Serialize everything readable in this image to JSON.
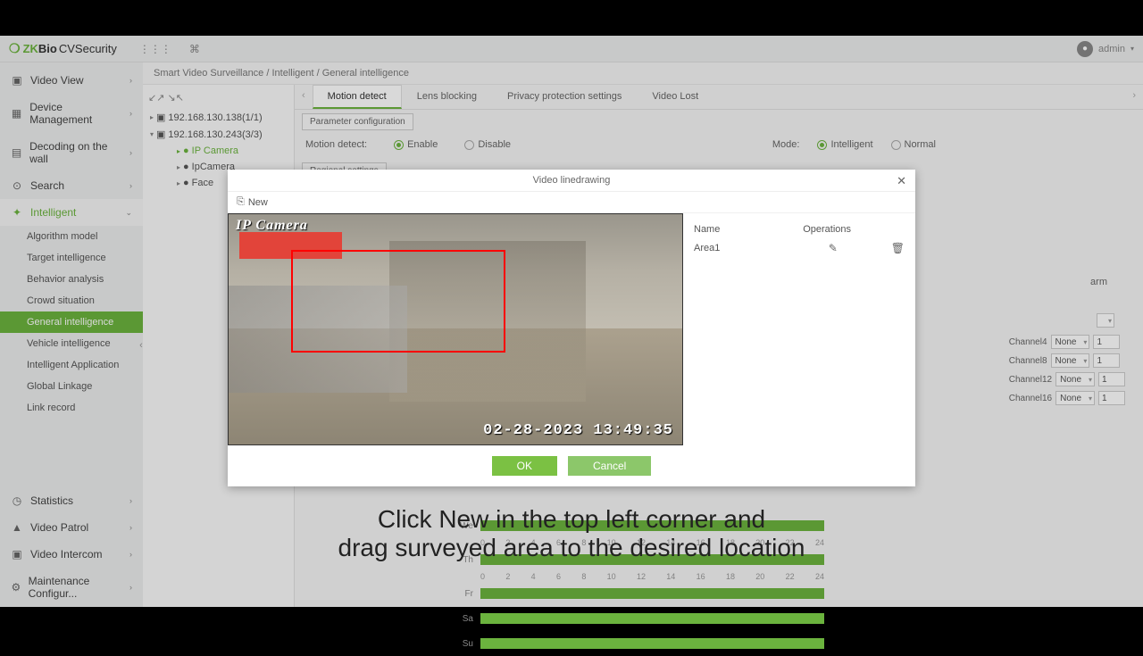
{
  "brand": {
    "zk": "ZK",
    "bio": "Bio",
    "cv": "CVSecurity"
  },
  "user": {
    "name": "admin"
  },
  "breadcrumb": "Smart Video Surveillance / Intelligent / General intelligence",
  "nav": {
    "videoView": "Video View",
    "deviceMgmt": "Device Management",
    "decoding": "Decoding on the wall",
    "search": "Search",
    "intelligent": "Intelligent",
    "statistics": "Statistics",
    "videoPatrol": "Video Patrol",
    "videoIntercom": "Video Intercom",
    "maintenance": "Maintenance Configur..."
  },
  "subnav": {
    "algo": "Algorithm model",
    "target": "Target intelligence",
    "behavior": "Behavior analysis",
    "crowd": "Crowd situation",
    "general": "General intelligence",
    "vehicle": "Vehicle intelligence",
    "intelApp": "Intelligent Application",
    "globalLink": "Global Linkage",
    "linkRecord": "Link record"
  },
  "tree": {
    "dev1": "192.168.130.138(1/1)",
    "dev2": "192.168.130.243(3/3)",
    "cam1": "IP Camera",
    "cam2": "IpCamera",
    "cam3": "Face"
  },
  "tabs": {
    "motion": "Motion detect",
    "lens": "Lens blocking",
    "privacy": "Privacy protection settings",
    "videoLost": "Video Lost"
  },
  "paramConfig": "Parameter configuration",
  "regionalSettings": "Regional settings",
  "labels": {
    "motionDetect": "Motion detect:",
    "enable": "Enable",
    "disable": "Disable",
    "mode": "Mode:",
    "intelligent": "Intelligent",
    "normal": "Normal",
    "arm": "arm",
    "none": "None"
  },
  "channels": [
    {
      "label": "Channel4",
      "value": "None",
      "num": "1"
    },
    {
      "label": "Channel8",
      "value": "None",
      "num": "1"
    },
    {
      "label": "Channel12",
      "value": "None",
      "num": "1"
    },
    {
      "label": "Channel16",
      "value": "None",
      "num": "1"
    }
  ],
  "schedule": {
    "days": [
      "We",
      "Th",
      "Fr",
      "Sa",
      "Su"
    ],
    "ticks": [
      "0",
      "2",
      "4",
      "6",
      "8",
      "10",
      "12",
      "14",
      "16",
      "18",
      "20",
      "22",
      "24"
    ]
  },
  "modal": {
    "title": "Video linedrawing",
    "new": "New",
    "nameCol": "Name",
    "opsCol": "Operations",
    "areas": [
      {
        "name": "Area1"
      }
    ],
    "camLabel": "IP Camera",
    "timestamp": "02-28-2023 13:49:35",
    "ok": "OK",
    "cancel": "Cancel"
  },
  "subtitle": {
    "line1": "Click New in the top left corner and",
    "line2": "drag surveyed area to the desired location"
  }
}
